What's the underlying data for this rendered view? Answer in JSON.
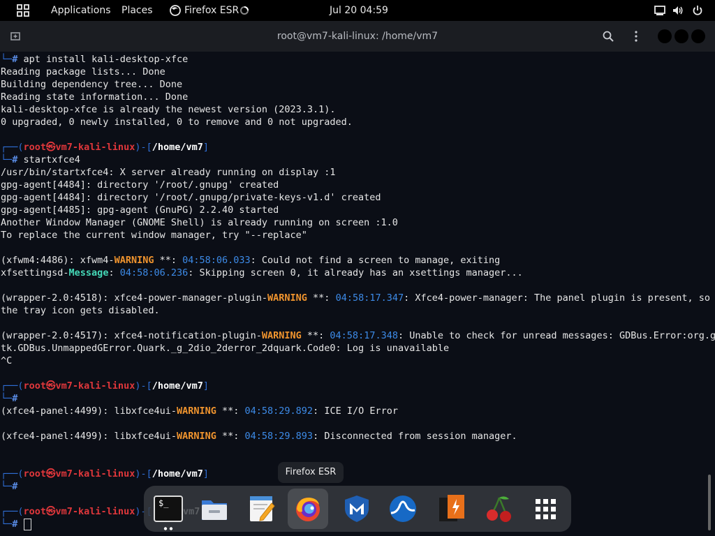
{
  "topbar": {
    "applications": "Applications",
    "places": "Places",
    "firefox": "Firefox ESR",
    "datetime": "Jul 20  04:59"
  },
  "window": {
    "title": "root@vm7-kali-linux: /home/vm7"
  },
  "terminal": {
    "l1": "apt install kali-desktop-xfce",
    "l2": "Reading package lists... Done",
    "l3": "Building dependency tree... Done",
    "l4": "Reading state information... Done",
    "l5": "kali-desktop-xfce is already the newest version (2023.3.1).",
    "l6": "0 upgraded, 0 newly installed, 0 to remove and 0 not upgraded.",
    "user": "root",
    "host": "vm7-kali-linux",
    "path": "/home/vm7",
    "cmd2": "startxfce4",
    "l9": "/usr/bin/startxfce4: X server already running on display :1",
    "l10": "gpg-agent[4484]: directory '/root/.gnupg' created",
    "l11": "gpg-agent[4484]: directory '/root/.gnupg/private-keys-v1.d' created",
    "l12": "gpg-agent[4485]: gpg-agent (GnuPG) 2.2.40 started",
    "l13": "Another Window Manager (GNOME Shell) is already running on screen :1.0",
    "l14": "To replace the current window manager, try \"--replace\"",
    "w1_pre": "(xfwm4:4486): xfwm4-",
    "w1_lvl": "WARNING",
    "w1_mid": " **: ",
    "w1_ts": "04:58:06.033",
    "w1_msg": ": Could not find a screen to manage, exiting",
    "w2_pre": "xfsettingsd-",
    "w2_lvl": "Message",
    "w2_mid": ": ",
    "w2_ts": "04:58:06.236",
    "w2_msg": ": Skipping screen 0, it already has an xsettings manager...",
    "w3_pre": "(wrapper-2.0:4518): xfce4-power-manager-plugin-",
    "w3_lvl": "WARNING",
    "w3_mid": " **: ",
    "w3_ts": "04:58:17.347",
    "w3_msg": ": Xfce4-power-manager: The panel plugin is present, so",
    "w3_cont": "the tray icon gets disabled.",
    "w4_pre": "(wrapper-2.0:4517): xfce4-notification-plugin-",
    "w4_lvl": "WARNING",
    "w4_mid": " **: ",
    "w4_ts": "04:58:17.348",
    "w4_msg": ": Unable to check for unread messages: GDBus.Error:org.g",
    "w4_cont": "tk.GDBus.UnmappedGError.Quark._g_2dio_2derror_2dquark.Code0: Log is unavailable",
    "ctrlc": "^C",
    "w5_pre": "(xfce4-panel:4499): libxfce4ui-",
    "w5_lvl": "WARNING",
    "w5_mid": " **: ",
    "w5_ts": "04:58:29.892",
    "w5_msg": ": ICE I/O Error",
    "w6_pre": "(xfce4-panel:4499): libxfce4ui-",
    "w6_lvl": "WARNING",
    "w6_mid": " **: ",
    "w6_ts": "04:58:29.893",
    "w6_msg": ": Disconnected from session manager.",
    "prompt_hash": "#",
    "path_partial": "vm7"
  },
  "dock": {
    "tooltip": "Firefox ESR",
    "apps": [
      "terminal-icon",
      "files-icon",
      "text-editor-icon",
      "firefox-icon",
      "metasploit-icon",
      "wireshark-icon",
      "burpsuite-icon",
      "cherrytree-icon",
      "app-grid-icon"
    ]
  },
  "colors": {
    "warning": "#f0942e",
    "timestamp": "#3d8be8",
    "prompt_user": "#e0373b",
    "prompt_path": "#5b8ee8"
  }
}
